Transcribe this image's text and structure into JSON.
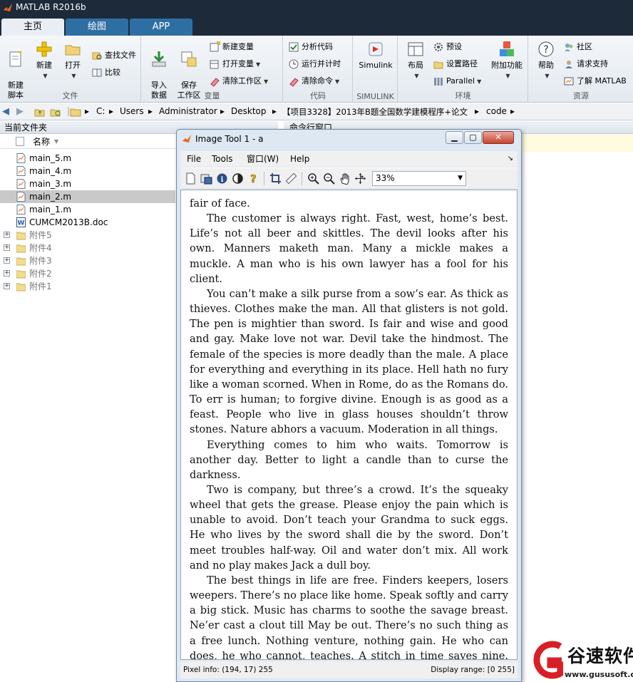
{
  "window": {
    "title": "MATLAB R2016b"
  },
  "tabs": [
    "主页",
    "绘图",
    "APP"
  ],
  "ribbon": {
    "file_group": {
      "label": "文件",
      "new_script": "新建\n脚本",
      "new": "新建",
      "open": "打开",
      "find_files": "查找文件",
      "compare": "比较"
    },
    "variable_group": {
      "label": "变量",
      "import_data": "导入\n数据",
      "save_workspace": "保存\n工作区",
      "new_variable": "新建变量",
      "open_variable": "打开变量",
      "clear_workspace": "清除工作区"
    },
    "code_group": {
      "label": "代码",
      "analyze_code": "分析代码",
      "run_and_time": "运行并计时",
      "clear_commands": "清除命令"
    },
    "simulink_group": {
      "label": "SIMULINK",
      "simulink": "Simulink"
    },
    "environment_group": {
      "label": "环境",
      "layout": "布局",
      "preferences": "预设",
      "set_path": "设置路径",
      "parallel": "Parallel",
      "addons": "附加功能"
    },
    "resources_group": {
      "label": "资源",
      "help": "帮助",
      "community": "社区",
      "request_support": "请求支持",
      "learn_matlab": "了解 MATLAB"
    }
  },
  "address": {
    "segments": [
      "C:",
      "Users",
      "Administrator",
      "Desktop",
      "【项目3328】2013年B题全国数学建模程序+论文",
      "code"
    ]
  },
  "current_folder": {
    "title": "当前文件夹",
    "column_name": "名称",
    "files": [
      {
        "name": "main_5.m",
        "type": "m"
      },
      {
        "name": "main_4.m",
        "type": "m"
      },
      {
        "name": "main_3.m",
        "type": "m"
      },
      {
        "name": "main_2.m",
        "type": "m",
        "selected": true
      },
      {
        "name": "main_1.m",
        "type": "m"
      },
      {
        "name": "CUMCM2013B.doc",
        "type": "doc"
      },
      {
        "name": "附件5",
        "type": "folder"
      },
      {
        "name": "附件4",
        "type": "folder"
      },
      {
        "name": "附件3",
        "type": "folder"
      },
      {
        "name": "附件2",
        "type": "folder"
      },
      {
        "name": "附件1",
        "type": "folder"
      }
    ]
  },
  "command_window": {
    "title": "命令行窗口"
  },
  "image_tool": {
    "title": "Image Tool 1 - a",
    "menu": [
      "File",
      "Tools",
      "窗口(W)",
      "Help"
    ],
    "zoom": "33%",
    "paragraphs": [
      "fair of face.",
      "The customer is always right. Fast, west, home’s best. Life’s not all beer and skittles. The devil looks after his own. Manners maketh man. Many a mickle makes a muckle. A man who is his own lawyer has a fool for his client.",
      "You can’t make a silk purse from a sow’s ear. As thick as thieves. Clothes make the man. All that glisters is not gold. The pen is mightier than sword. Is fair and wise and good and gay. Make love not war. Devil take the hindmost. The female of the species is more deadly than the male. A place for everything and everything in its place. Hell hath no fury like a woman scorned. When in Rome, do as the Romans do. To err is human; to forgive divine. Enough is as good as a feast. People who live in glass houses shouldn’t throw stones. Nature abhors a vacuum. Moderation in all things.",
      "Everything comes to him who waits. Tomorrow is another day. Better to light a candle than to curse the darkness.",
      "Two is company, but three’s a crowd. It’s the squeaky wheel that gets the grease. Please enjoy the pain which is unable to avoid. Don’t teach your Grandma to suck eggs. He who lives by the sword shall die by the sword. Don’t meet troubles half-way. Oil and water don’t mix. All work and no play makes Jack a dull boy.",
      "The best things in life are free. Finders keepers, losers weepers. There’s no place like home. Speak softly and carry a big stick. Music has charms to soothe the savage breast. Ne’er cast a clout till May be out. There’s no such thing as a free lunch. Nothing venture, nothing gain. He who can does, he who cannot, teaches. A stitch in time saves nine. The child is the father of the man. And a child that’s born on the Sab-"
    ],
    "status_pixel_info": "Pixel info: (194, 17)  255",
    "status_display_range": "Display range: [0 255]"
  },
  "watermark": {
    "brand": "谷速软件",
    "url": "www.gususoft.com"
  },
  "colors": {
    "titlebar": "#1d2a3a",
    "tab_active": "#e8eef4",
    "tab_inactive": "#2e6fa3",
    "selection": "#c9c9c9"
  }
}
